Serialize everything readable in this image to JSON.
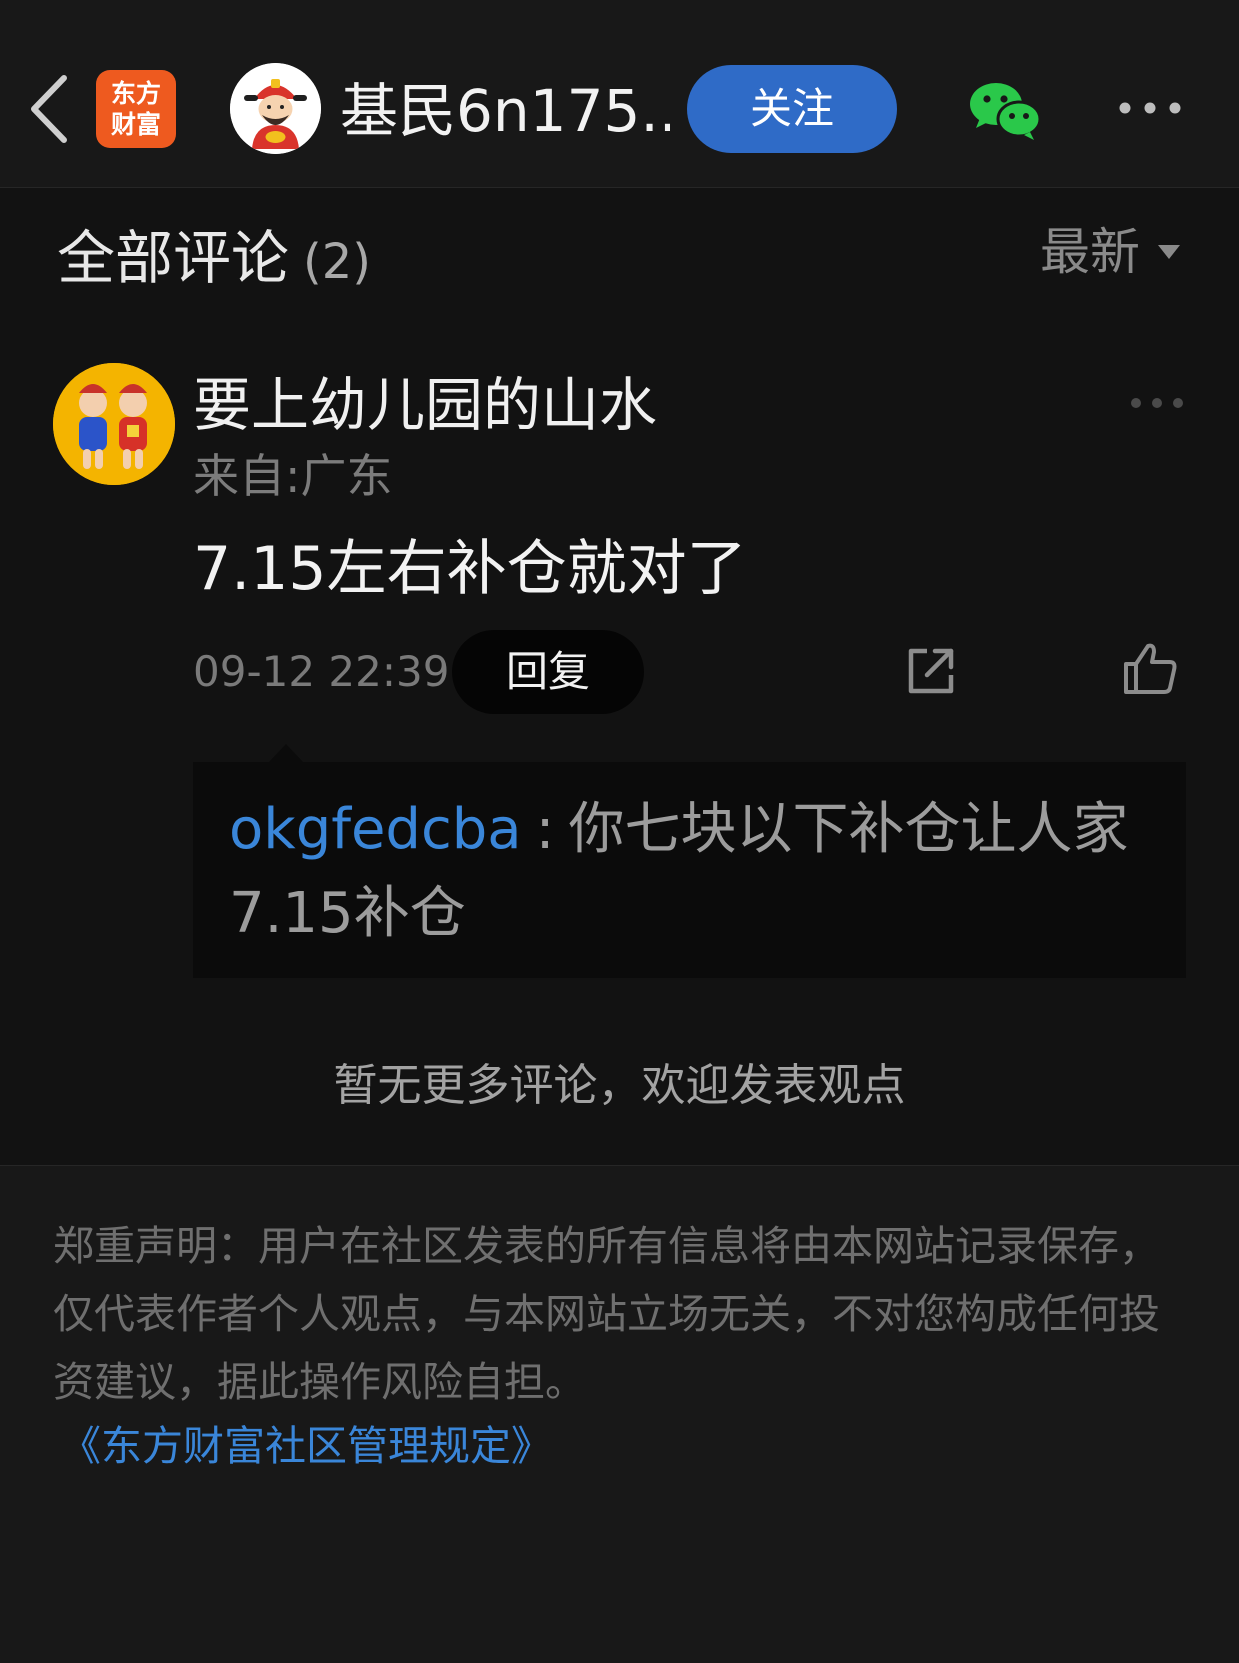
{
  "header": {
    "brand_logo_line1": "东方",
    "brand_logo_line2": "财富",
    "author_name": "基民6n175...",
    "follow_label": "关注",
    "icons": {
      "back": "chevron-left-icon",
      "share": "wechat-icon",
      "more": "more-dots-icon"
    }
  },
  "comments": {
    "title": "全部评论",
    "count": "(2)",
    "sort_label": "最新"
  },
  "comment": {
    "user_name": "要上幼儿园的山水",
    "location": "来自:广东",
    "text": "7.15左右补仓就对了",
    "time": "09-12 22:39",
    "reply_label": "回复",
    "reply": {
      "user": "okgfedcba",
      "separator": ":",
      "text": "你七块以下补仓让人家7.15补仓"
    }
  },
  "footer": {
    "no_more_text": "暂无更多评论，欢迎发表观点",
    "disclaimer": "郑重声明：用户在社区发表的所有信息将由本网站记录保存，仅代表作者个人观点，与本网站立场无关，不对您构成任何投资建议，据此操作风险自担。",
    "rules_link": "《东方财富社区管理规定》"
  },
  "colors": {
    "background": "#121212",
    "follow_button": "#2f6bc7",
    "link_blue": "#3a86d9",
    "brand_orange": "#ee5a1f",
    "wechat_green": "#2ac84a"
  }
}
